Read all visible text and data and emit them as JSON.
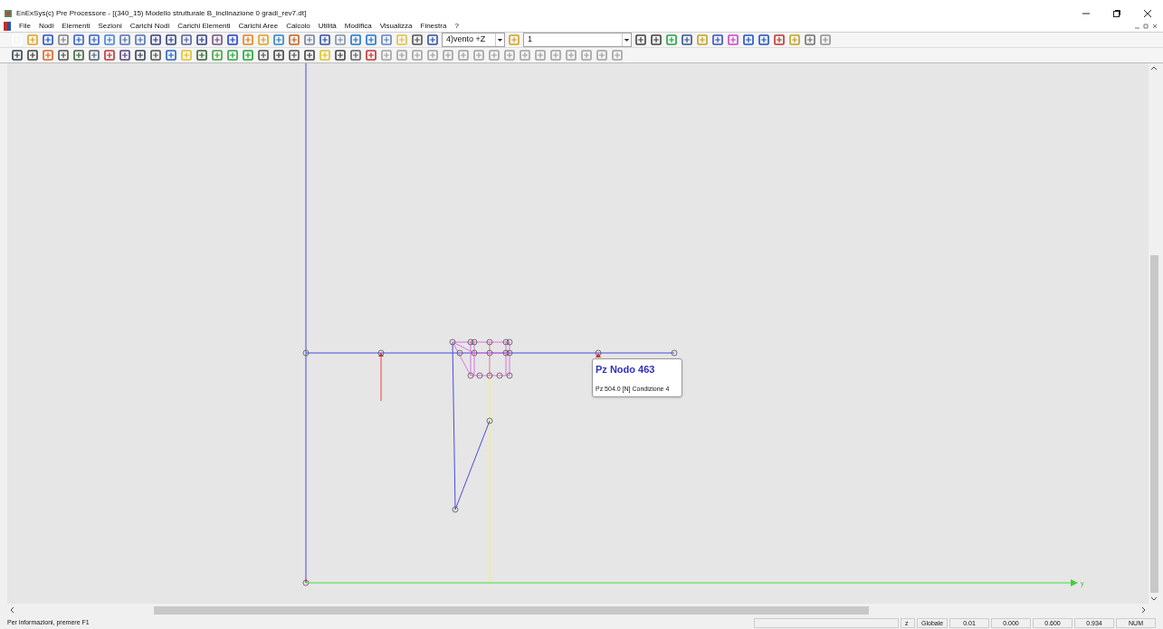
{
  "window": {
    "title": "EnExSys(c) Pre Processore - [(340_15) Modello strutturale B_inclinazione 0 gradi_rev7.dt]"
  },
  "menu": [
    "File",
    "Nodi",
    "Elementi",
    "Sezioni",
    "Carichi Nodi",
    "Carichi Elementi",
    "Carichi Aree",
    "Calcolo",
    "Utilità",
    "Modifica",
    "Visualizza",
    "Finestra",
    "?"
  ],
  "toolbar": {
    "load_case": "4)vento +Z",
    "step": "1"
  },
  "canvas": {
    "axis_label": "y",
    "tooltip": {
      "title": "Pz Nodo 463",
      "text": "Pz 504.0 [N] Condizione 4"
    }
  },
  "status_bar": {
    "message": "Per informazioni, premere F1",
    "fields": [
      "z",
      "Globale",
      "0.01",
      "0.000",
      "0.600",
      "0.934",
      "NUM"
    ]
  }
}
